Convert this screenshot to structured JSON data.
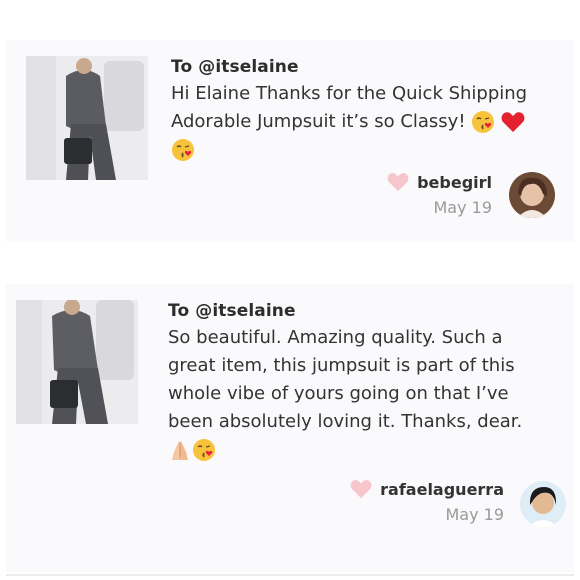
{
  "reviews": [
    {
      "to": "To @itselaine",
      "lines": [
        "Hi Elaine Thanks for the Quick Shipping",
        "Adorable Jumpsuit it’s so Classy!"
      ],
      "user": "bebegirl",
      "date": "May 19"
    },
    {
      "to": "To @itselaine",
      "lines": [
        "So beautiful. Amazing quality. Such a",
        "great item, this jumpsuit is part of this",
        "whole vibe of yours going on that I’ve",
        "been absolutely loving it. Thanks, dear."
      ],
      "user": "rafaelaguerra",
      "date": "May 19"
    }
  ],
  "icons": {
    "like": "heart-icon",
    "kiss": "kissing-face-emoji",
    "red_heart": "red-heart-emoji",
    "pray": "folded-hands-emoji"
  },
  "colors": {
    "like_heart": "#f7c6cc",
    "card_bg": "#faf9fb",
    "date_text": "#9a9a9a"
  }
}
